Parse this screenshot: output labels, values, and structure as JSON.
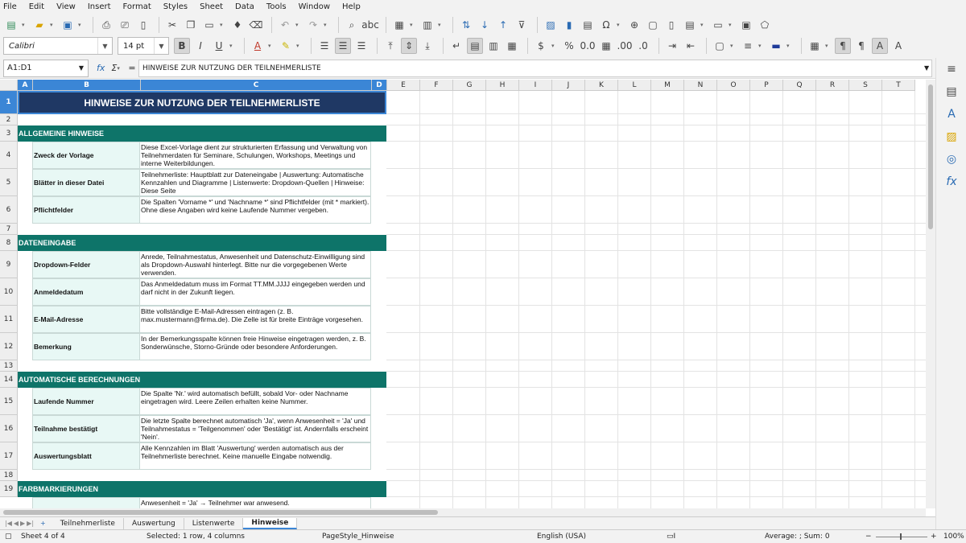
{
  "menu": [
    "File",
    "Edit",
    "View",
    "Insert",
    "Format",
    "Styles",
    "Sheet",
    "Data",
    "Tools",
    "Window",
    "Help"
  ],
  "toolbar": {
    "font_name": "Calibri",
    "font_size": "14 pt"
  },
  "namebox": "A1:D1",
  "formula": "HINWEISE ZUR NUTZUNG DER TEILNEHMERLISTE",
  "columns": [
    "A",
    "B",
    "C",
    "D",
    "E",
    "F",
    "G",
    "H",
    "I",
    "J",
    "K",
    "L",
    "M",
    "N",
    "O",
    "P",
    "Q",
    "R",
    "S",
    "T"
  ],
  "rows": [
    "1",
    "2",
    "3",
    "4",
    "5",
    "6",
    "7",
    "8",
    "9",
    "10",
    "11",
    "12",
    "13",
    "14",
    "15",
    "16",
    "17",
    "18",
    "19"
  ],
  "title": "HINWEISE ZUR NUTZUNG DER TEILNEHMERLISTE",
  "sections": [
    {
      "name": "ALLGEMEINE HINWEISE",
      "items": [
        {
          "label": "Zweck der Vorlage",
          "text": "Diese Excel-Vorlage dient zur strukturierten Erfassung und Verwaltung von Teilnehmerdaten für Seminare, Schulungen, Workshops, Meetings und interne Weiterbildungen."
        },
        {
          "label": "Blätter in dieser Datei",
          "text": "Teilnehmerliste: Hauptblatt zur Dateneingabe | Auswertung: Automatische Kennzahlen und Diagramme | Listenwerte: Dropdown-Quellen | Hinweise: Diese Seite"
        },
        {
          "label": "Pflichtfelder",
          "text": "Die Spalten 'Vorname *' und 'Nachname *' sind Pflichtfelder (mit * markiert). Ohne diese Angaben wird keine Laufende Nummer vergeben."
        }
      ]
    },
    {
      "name": "DATENEINGABE",
      "items": [
        {
          "label": "Dropdown-Felder",
          "text": "Anrede, Teilnahmestatus, Anwesenheit und Datenschutz-Einwilligung sind als Dropdown-Auswahl hinterlegt. Bitte nur die vorgegebenen Werte verwenden."
        },
        {
          "label": "Anmeldedatum",
          "text": "Das Anmeldedatum muss im Format TT.MM.JJJJ eingegeben werden und darf nicht in der Zukunft liegen."
        },
        {
          "label": "E-Mail-Adresse",
          "text": "Bitte vollständige E-Mail-Adressen eintragen (z. B. max.mustermann@firma.de). Die Zelle ist für breite Einträge vorgesehen."
        },
        {
          "label": "Bemerkung",
          "text": "In der Bemerkungsspalte können freie Hinweise eingetragen werden, z. B. Sonderwünsche, Storno-Gründe oder besondere Anforderungen."
        }
      ]
    },
    {
      "name": "AUTOMATISCHE BERECHNUNGEN",
      "items": [
        {
          "label": "Laufende Nummer",
          "text": "Die Spalte 'Nr.' wird automatisch befüllt, sobald Vor- oder Nachname eingetragen wird. Leere Zeilen erhalten keine Nummer."
        },
        {
          "label": "Teilnahme bestätigt",
          "text": "Die letzte Spalte berechnet automatisch 'Ja', wenn Anwesenheit = 'Ja' und Teilnahmestatus = 'Teilgenommen' oder 'Bestätigt' ist. Andernfalls erscheint 'Nein'."
        },
        {
          "label": "Auswertungsblatt",
          "text": "Alle Kennzahlen im Blatt 'Auswertung' werden automatisch aus der Teilnehmerliste berechnet. Keine manuelle Eingabe notwendig."
        }
      ]
    },
    {
      "name": "FARBMARKIERUNGEN",
      "items": [
        {
          "label": "",
          "text": "Anwesenheit = 'Ja' → Teilnehmer war anwesend."
        }
      ]
    }
  ],
  "tabs": [
    "Teilnehmerliste",
    "Auswertung",
    "Listenwerte",
    "Hinweise"
  ],
  "status": {
    "sheet": "Sheet 4 of 4",
    "selected": "Selected: 1 row, 4 columns",
    "pagestyle": "PageStyle_Hinweise",
    "lang": "English (USA)",
    "sum": "Average: ; Sum: 0",
    "zoom": "100%"
  },
  "colors": {
    "title_bg": "#1f3864",
    "section_bg": "#0e7469",
    "label_bg": "#e8f8f5",
    "selection": "#3b86d6"
  }
}
